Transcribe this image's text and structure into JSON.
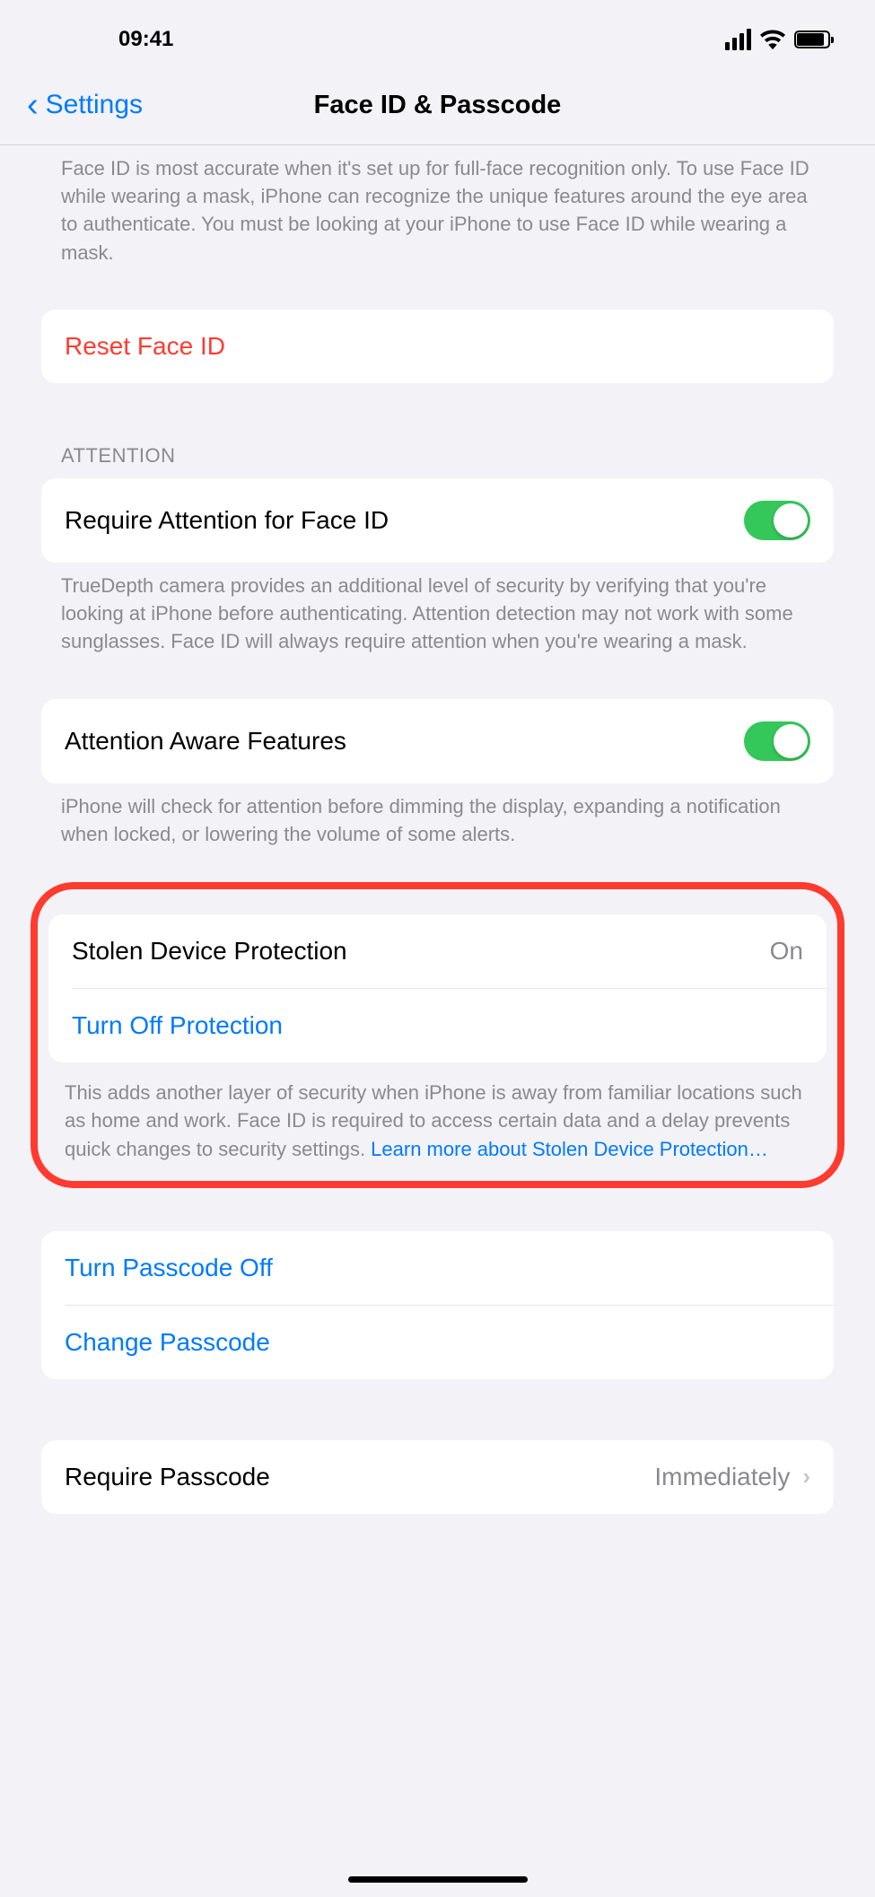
{
  "statusbar": {
    "time": "09:41"
  },
  "nav": {
    "back": "Settings",
    "title": "Face ID & Passcode"
  },
  "intro_footer": "Face ID is most accurate when it's set up for full-face recognition only. To use Face ID while wearing a mask, iPhone can recognize the unique features around the eye area to authenticate. You must be looking at your iPhone to use Face ID while wearing a mask.",
  "reset": {
    "label": "Reset Face ID"
  },
  "attention": {
    "header": "ATTENTION",
    "require_label": "Require Attention for Face ID",
    "require_footer": "TrueDepth camera provides an additional level of security by verifying that you're looking at iPhone before authenticating. Attention detection may not work with some sunglasses. Face ID will always require attention when you're wearing a mask.",
    "aware_label": "Attention Aware Features",
    "aware_footer": "iPhone will check for attention before dimming the display, expanding a notification when locked, or lowering the volume of some alerts."
  },
  "stolen": {
    "label": "Stolen Device Protection",
    "value": "On",
    "turn_off": "Turn Off Protection",
    "footer_text": "This adds another layer of security when iPhone is away from familiar locations such as home and work. Face ID is required to access certain data and a delay prevents quick changes to security settings. ",
    "learn_more": "Learn more about Stolen Device Protection…"
  },
  "passcode": {
    "turn_off": "Turn Passcode Off",
    "change": "Change Passcode",
    "require_label": "Require Passcode",
    "require_value": "Immediately"
  }
}
